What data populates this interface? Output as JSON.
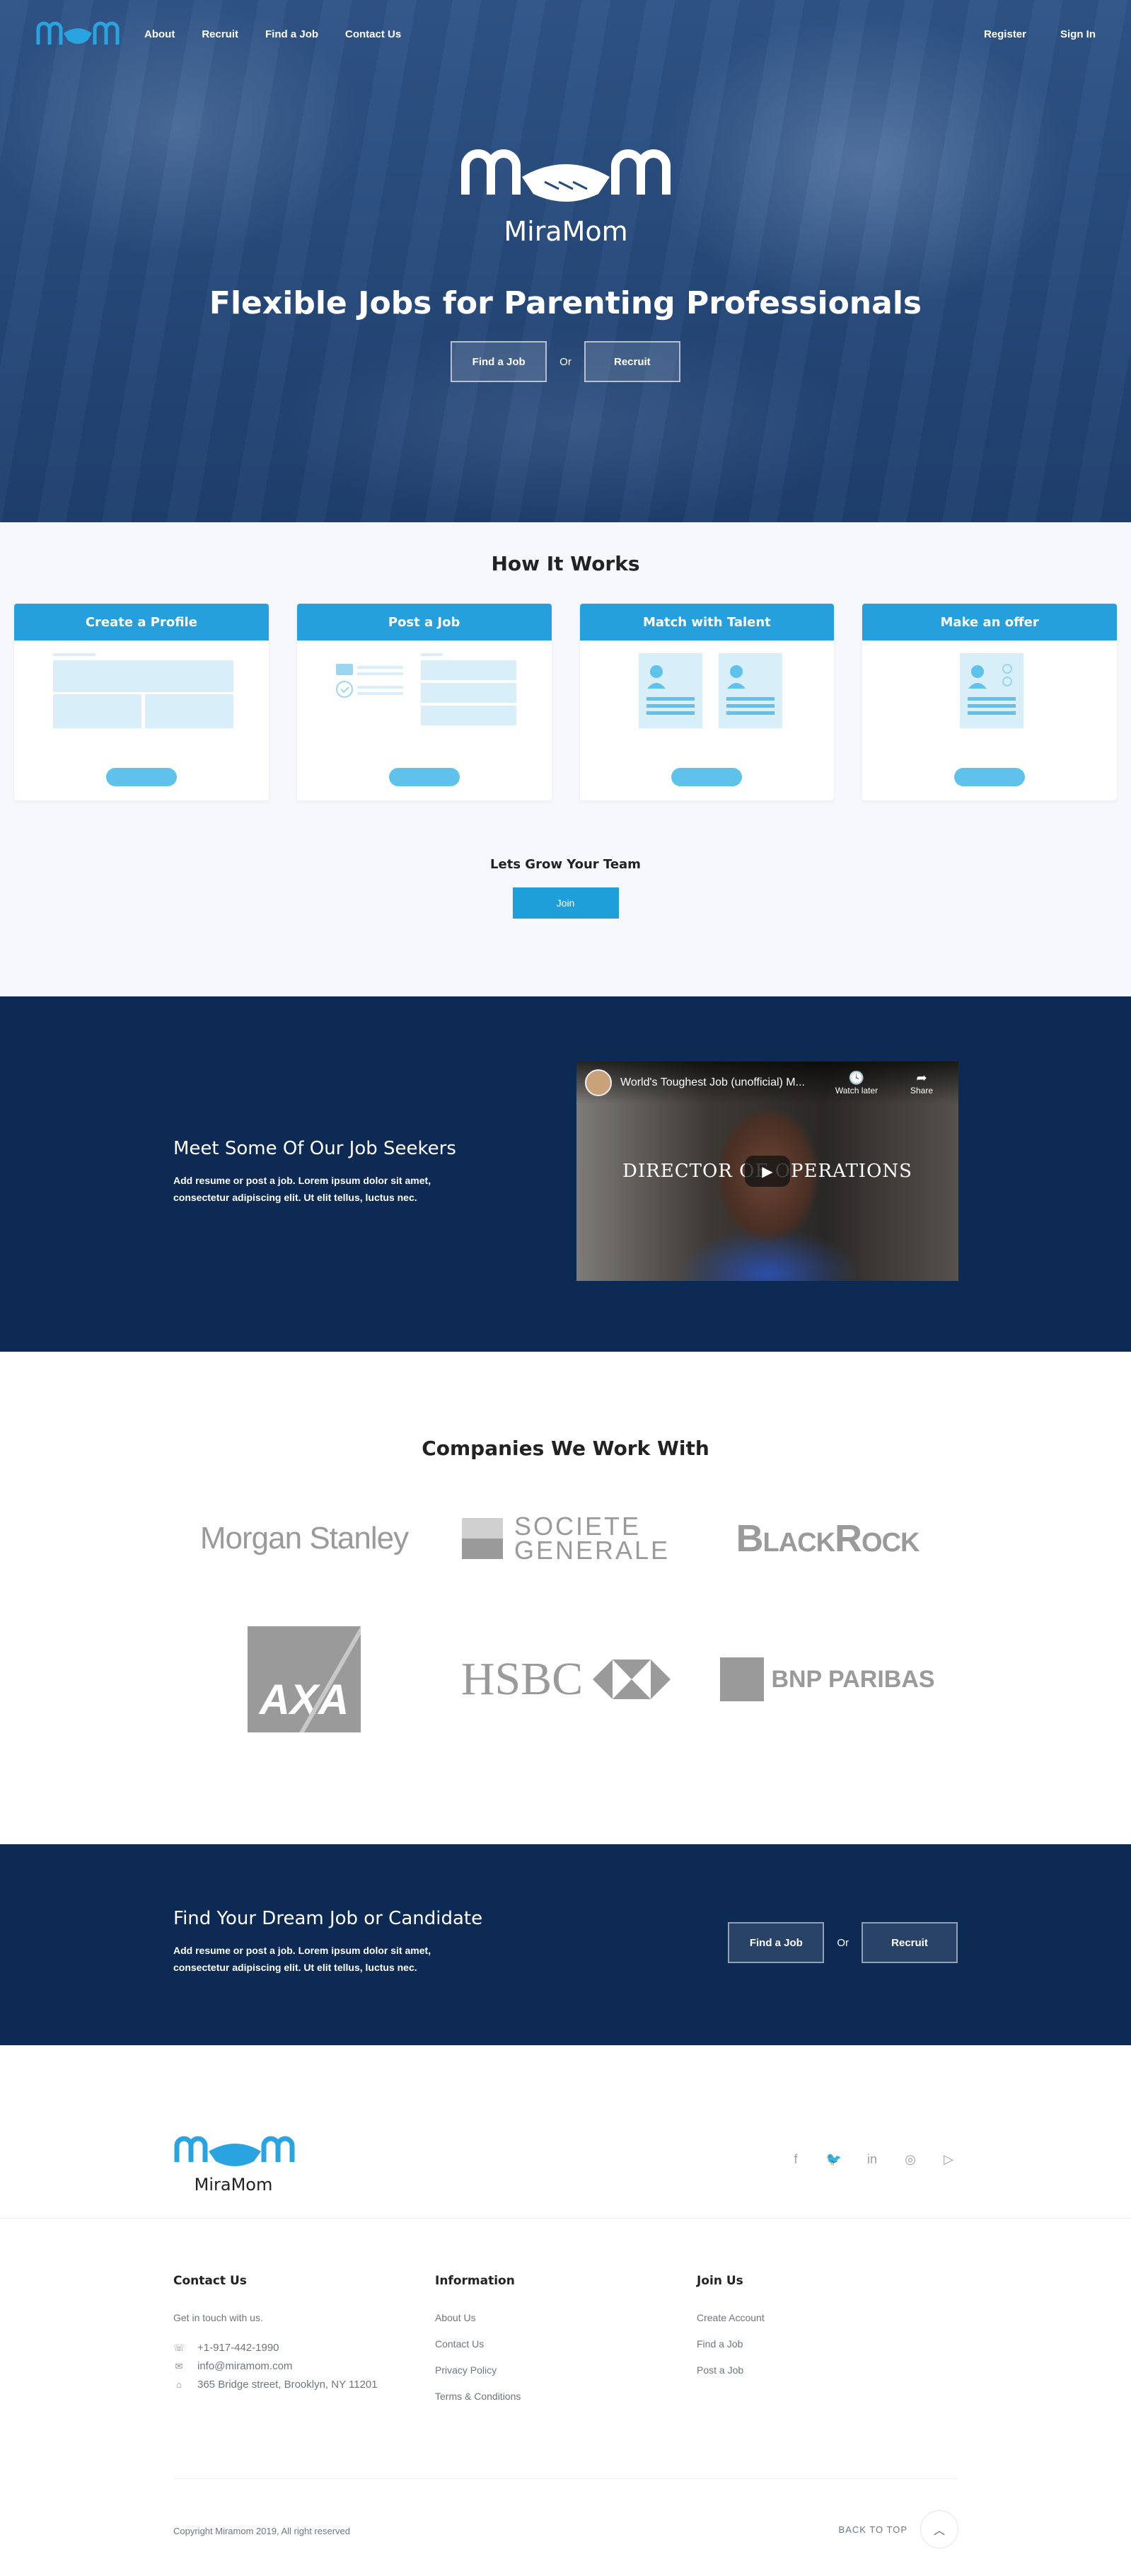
{
  "nav": {
    "links": [
      "About",
      "Recruit",
      "Find a Job",
      "Contact Us"
    ],
    "register": "Register",
    "sign_in": "Sign In"
  },
  "hero": {
    "brand": "MiraMom",
    "title": "Flexible Jobs for Parenting Professionals",
    "find_job": "Find a Job",
    "or": "Or",
    "recruit": "Recruit"
  },
  "how": {
    "title": "How It Works",
    "cards": [
      "Create a Profile",
      "Post a Job",
      "Match with Talent",
      "Make an offer"
    ],
    "grow_title": "Lets Grow Your Team",
    "join": "Join"
  },
  "seekers": {
    "title": "Meet Some Of Our Job Seekers",
    "text": "Add resume or post a job. Lorem ipsum dolor sit amet, consectetur adipiscing elit. Ut elit tellus, luctus nec.",
    "video": {
      "title": "World's Toughest Job (unofficial) M...",
      "watch_later": "Watch later",
      "share": "Share",
      "overlay": "DIRECTOR OF OPERATIONS"
    }
  },
  "companies": {
    "title": "Companies We Work With",
    "morgan": "Morgan Stanley",
    "sg_line1": "SOCIETE",
    "sg_line2": "GENERALE",
    "blackrock": "BlackRock",
    "axa": "AXA",
    "hsbc": "HSBC",
    "bnp": "BNP PARIBAS"
  },
  "dream": {
    "title": "Find Your Dream Job or Candidate",
    "text": "Add resume or post a job. Lorem ipsum dolor sit amet, consectetur adipiscing elit. Ut elit tellus, luctus nec.",
    "find_job": "Find a Job",
    "or": "Or",
    "recruit": "Recruit"
  },
  "footer": {
    "brand": "MiraMom",
    "contact": {
      "title": "Contact Us",
      "subtitle": "Get in touch with us.",
      "phone": "+1-917-442-1990",
      "email": "info@miramom.com",
      "address": "365 Bridge street, Brooklyn, NY 11201"
    },
    "information": {
      "title": "Information",
      "links": [
        "About Us",
        "Contact Us",
        "Privacy Policy",
        "Terms & Conditions"
      ]
    },
    "join": {
      "title": "Join Us",
      "links": [
        "Create Account",
        "Find a Job",
        "Post a Job"
      ]
    },
    "copyright": "Copyright Miramom 2019, All right reserved",
    "back_to_top": "BACK TO TOP"
  },
  "colors": {
    "accent": "#26a0dc",
    "navy": "#0c2a54",
    "hero": "#274b7d"
  }
}
